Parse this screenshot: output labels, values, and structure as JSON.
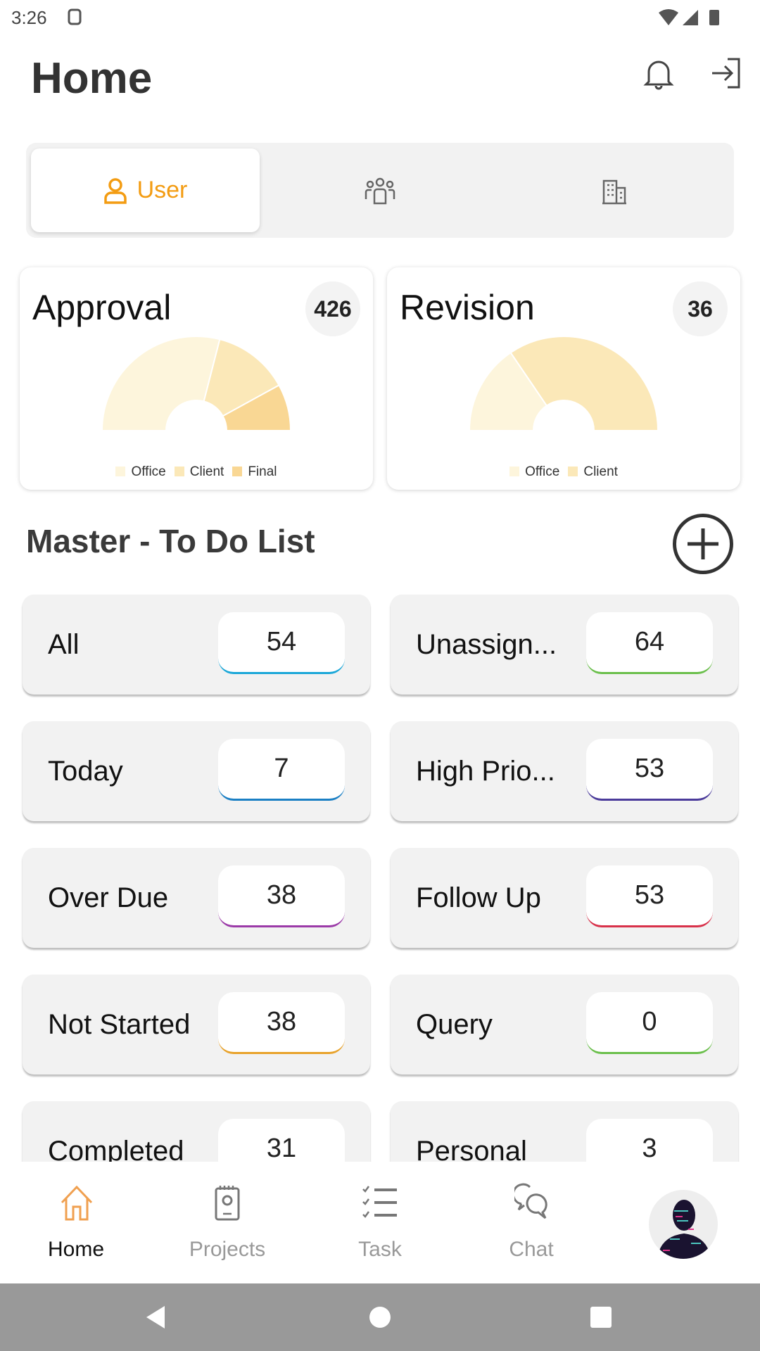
{
  "status_bar": {
    "time": "3:26"
  },
  "header": {
    "title": "Home"
  },
  "tabs": [
    {
      "label": "User",
      "icon": "user-icon",
      "selected": true
    },
    {
      "label": "",
      "icon": "team-icon"
    },
    {
      "label": "",
      "icon": "building-icon"
    }
  ],
  "accent": "#f39c12",
  "approval": {
    "title": "Approval",
    "count": "426",
    "legend": [
      "Office",
      "Client",
      "Final"
    ],
    "colors": [
      "#fdf5dc",
      "#fbe8b8",
      "#f9d794"
    ],
    "shares": [
      0.58,
      0.26,
      0.16
    ]
  },
  "revision": {
    "title": "Revision",
    "count": "36",
    "legend": [
      "Office",
      "Client"
    ],
    "colors": [
      "#fdf5dc",
      "#fbe8b8"
    ],
    "shares": [
      0.31,
      0.69
    ]
  },
  "todo": {
    "title": "Master - To Do List",
    "items": [
      {
        "label": "All",
        "count": "54",
        "color": "#1aa7d8"
      },
      {
        "label": "Unassign...",
        "count": "64",
        "color": "#6abf4b"
      },
      {
        "label": "Today",
        "count": "7",
        "color": "#1a7fc4"
      },
      {
        "label": "High Prio...",
        "count": "53",
        "color": "#4a3a9a"
      },
      {
        "label": "Over Due",
        "count": "38",
        "color": "#9b3aa8"
      },
      {
        "label": "Follow Up",
        "count": "53",
        "color": "#d8314a"
      },
      {
        "label": "Not Started",
        "count": "38",
        "color": "#e8a22a"
      },
      {
        "label": "Query",
        "count": "0",
        "color": "#6abf4b"
      },
      {
        "label": "Completed",
        "count": "31",
        "color": "#6abf4b"
      },
      {
        "label": "Personal",
        "count": "3",
        "color": "#1aa7d8"
      }
    ]
  },
  "nav": {
    "home": "Home",
    "projects": "Projects",
    "task": "Task",
    "chat": "Chat"
  }
}
